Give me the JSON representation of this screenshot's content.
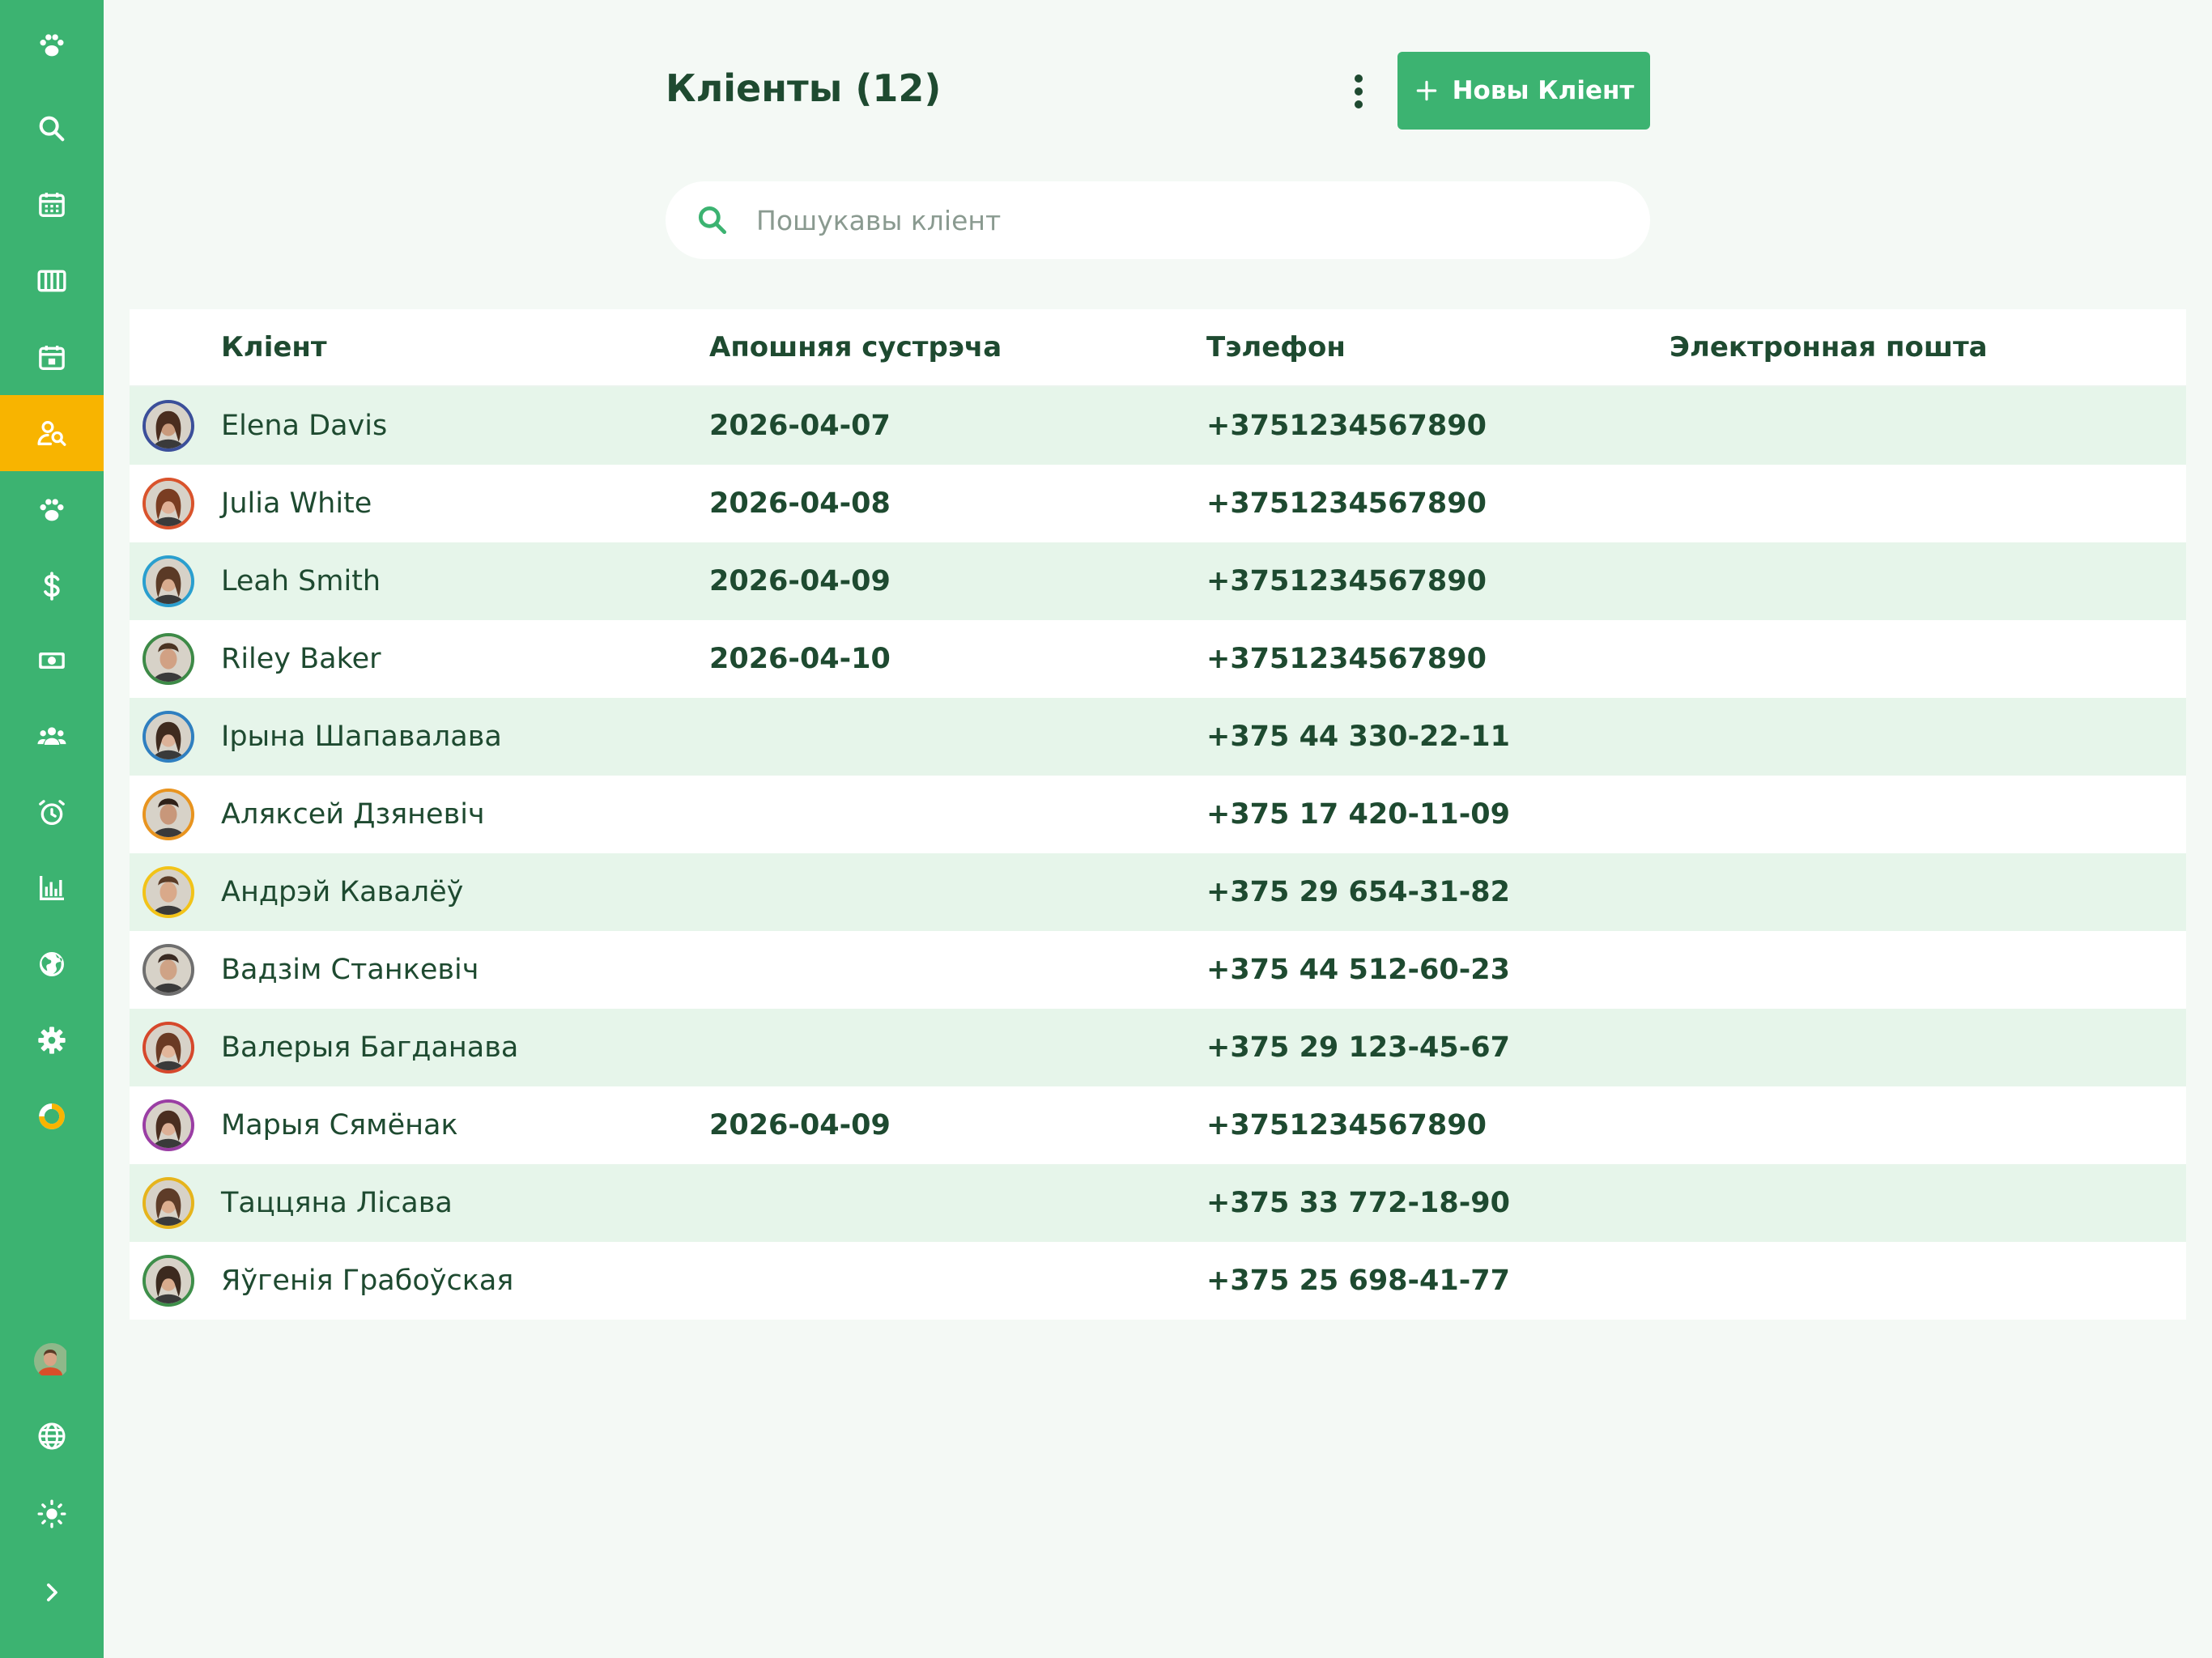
{
  "sidebar": {
    "items": [
      {
        "icon": "paw-icon",
        "name": "nav-paws-logo"
      },
      {
        "icon": "search-icon",
        "name": "nav-search"
      },
      {
        "icon": "calendar-grid-icon",
        "name": "nav-calendar"
      },
      {
        "icon": "columns-icon",
        "name": "nav-columns"
      },
      {
        "icon": "calendar-day-icon",
        "name": "nav-day-calendar"
      },
      {
        "icon": "client-search-icon",
        "name": "nav-clients",
        "active": true
      },
      {
        "icon": "paw-icon",
        "name": "nav-pets"
      },
      {
        "icon": "dollar-icon",
        "name": "nav-prices"
      },
      {
        "icon": "banknote-icon",
        "name": "nav-payments"
      },
      {
        "icon": "users-icon",
        "name": "nav-staff"
      },
      {
        "icon": "alarm-clock-icon",
        "name": "nav-reminders"
      },
      {
        "icon": "bar-chart-icon",
        "name": "nav-reports"
      },
      {
        "icon": "globe-icon",
        "name": "nav-online"
      },
      {
        "icon": "gear-icon",
        "name": "nav-settings"
      },
      {
        "icon": "donut-icon",
        "name": "nav-progress"
      }
    ],
    "bottom": [
      {
        "icon": "user-avatar",
        "name": "nav-profile"
      },
      {
        "icon": "language-globe-icon",
        "name": "nav-language"
      },
      {
        "icon": "sun-icon",
        "name": "nav-theme"
      },
      {
        "icon": "chevron-right-icon",
        "name": "nav-expand"
      }
    ]
  },
  "header": {
    "title": "Клiенты (12)",
    "add_button_label": "Новы Клiент"
  },
  "search": {
    "placeholder": "Пошукавы клiент",
    "value": ""
  },
  "table": {
    "columns": [
      "Клiент",
      "Апошняя сустрэча",
      "Тэлефон",
      "Электронная пошта"
    ],
    "rows": [
      {
        "name": "Elena Davis",
        "last_visit": "2026-04-07",
        "phone": "+3751234567890",
        "email": "",
        "ring": "#3b4f9a",
        "face": "#c99a7c",
        "hair": "#4a2d1f",
        "male": false
      },
      {
        "name": "Julia White",
        "last_visit": "2026-04-08",
        "phone": "+3751234567890",
        "email": "",
        "ring": "#d9532c",
        "face": "#e0b096",
        "hair": "#7a3d22",
        "male": false
      },
      {
        "name": "Leah Smith",
        "last_visit": "2026-04-09",
        "phone": "+3751234567890",
        "email": "",
        "ring": "#2a9fcf",
        "face": "#d8ab8e",
        "hair": "#5b3a26",
        "male": false
      },
      {
        "name": "Riley Baker",
        "last_visit": "2026-04-10",
        "phone": "+3751234567890",
        "email": "",
        "ring": "#3d8a47",
        "face": "#d1a184",
        "hair": "#4b3322",
        "male": true
      },
      {
        "name": "Ірына Шапавалава",
        "last_visit": "",
        "phone": "+375 44 330-22-11",
        "email": "",
        "ring": "#2f7fc0",
        "face": "#dcb299",
        "hair": "#3f2a1e",
        "male": false
      },
      {
        "name": "Аляксей Дзяневіч",
        "last_visit": "",
        "phone": "+375 17 420-11-09",
        "email": "",
        "ring": "#e8941f",
        "face": "#c8977a",
        "hair": "#2f2119",
        "male": true
      },
      {
        "name": "Андрэй Кавалёў",
        "last_visit": "",
        "phone": "+375 29 654-31-82",
        "email": "",
        "ring": "#f2c318",
        "face": "#d9a98a",
        "hair": "#5a3b27",
        "male": true
      },
      {
        "name": "Вадзім Станкевіч",
        "last_visit": "",
        "phone": "+375 44 512-60-23",
        "email": "",
        "ring": "#6f6f6f",
        "face": "#cfa386",
        "hair": "#3a2a22",
        "male": true
      },
      {
        "name": "Валерыя Багданава",
        "last_visit": "",
        "phone": "+375 29 123-45-67",
        "email": "",
        "ring": "#d6482c",
        "face": "#e2b59a",
        "hair": "#6a3a24",
        "male": false
      },
      {
        "name": "Марыя Сямёнак",
        "last_visit": "2026-04-09",
        "phone": "+3751234567890",
        "email": "",
        "ring": "#9a3ea4",
        "face": "#ddb096",
        "hair": "#4a2e20",
        "male": false
      },
      {
        "name": "Таццяна Лісава",
        "last_visit": "",
        "phone": "+375 33 772-18-90",
        "email": "",
        "ring": "#e6b41c",
        "face": "#dcae8f",
        "hair": "#5e3c28",
        "male": false
      },
      {
        "name": "Яўгенія Грабоўская",
        "last_visit": "",
        "phone": "+375 25 698-41-77",
        "email": "",
        "ring": "#3e8f4a",
        "face": "#d9ab8d",
        "hair": "#3c2a1f",
        "male": false
      }
    ]
  },
  "colors": {
    "brand_green": "#3cb371",
    "active_nav": "#f8b400",
    "text_dark_green": "#1e4a30",
    "row_stripe": "#e6f5ea"
  }
}
